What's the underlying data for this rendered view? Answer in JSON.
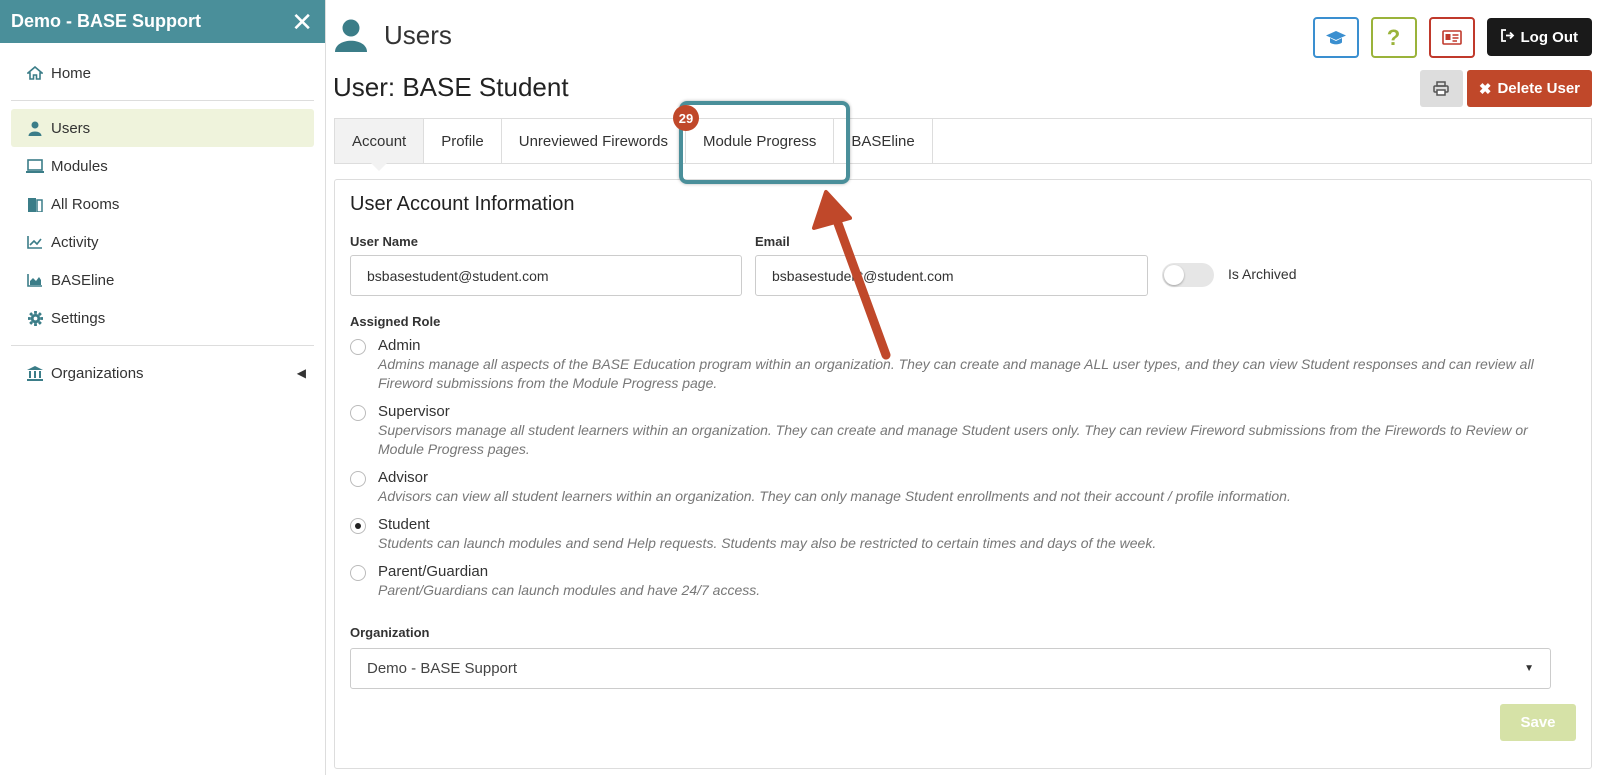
{
  "sidebar": {
    "title": "Demo - BASE Support",
    "items": [
      {
        "label": "Home",
        "icon": "home-icon"
      },
      {
        "label": "Users",
        "icon": "user-icon"
      },
      {
        "label": "Modules",
        "icon": "monitor-icon"
      },
      {
        "label": "All Rooms",
        "icon": "door-icon"
      },
      {
        "label": "Activity",
        "icon": "line-chart-icon"
      },
      {
        "label": "BASEline",
        "icon": "area-chart-icon"
      },
      {
        "label": "Settings",
        "icon": "gear-icon"
      },
      {
        "label": "Organizations",
        "icon": "bank-icon"
      }
    ],
    "active_item": "Users"
  },
  "header": {
    "title": "Users",
    "logout_label": "Log Out"
  },
  "user": {
    "title": "User: BASE Student",
    "delete_label": "Delete User"
  },
  "tabs": [
    {
      "label": "Account"
    },
    {
      "label": "Profile"
    },
    {
      "label": "Unreviewed Firewords"
    },
    {
      "label": "Module Progress"
    },
    {
      "label": "BASEline"
    }
  ],
  "badge_count": "29",
  "account": {
    "heading": "User Account Information",
    "username_label": "User Name",
    "username_value": "bsbasestudent@student.com",
    "email_label": "Email",
    "email_value": "bsbasestudent@student.com",
    "archived_label": "Is Archived",
    "archived": false,
    "role_label": "Assigned Role",
    "roles": [
      {
        "name": "Admin",
        "desc": "Admins manage all aspects of the BASE Education program within an organization. They can create and manage ALL user types, and they can view Student responses and can review all Fireword submissions from the Module Progress page."
      },
      {
        "name": "Supervisor",
        "desc": "Supervisors manage all student learners within an organization. They can create and manage Student users only. They can review Fireword submissions from the Firewords to Review or Module Progress pages."
      },
      {
        "name": "Advisor",
        "desc": "Advisors can view all student learners within an organization. They can only manage Student enrollments and not their account / profile information."
      },
      {
        "name": "Student",
        "desc": "Students can launch modules and send Help requests. Students may also be restricted to certain times and days of the week."
      },
      {
        "name": "Parent/Guardian",
        "desc": "Parent/Guardians can launch modules and have 24/7 access."
      }
    ],
    "selected_role": "Student",
    "organization_label": "Organization",
    "organization_value": "Demo - BASE Support",
    "save_label": "Save"
  },
  "colors": {
    "sidebar_header": "#4a8f9a",
    "delete": "#c0482a",
    "save_disabled": "#d6e2a7",
    "annotation_arrow": "#c0482a",
    "annotation_box": "#4a8f9a"
  }
}
